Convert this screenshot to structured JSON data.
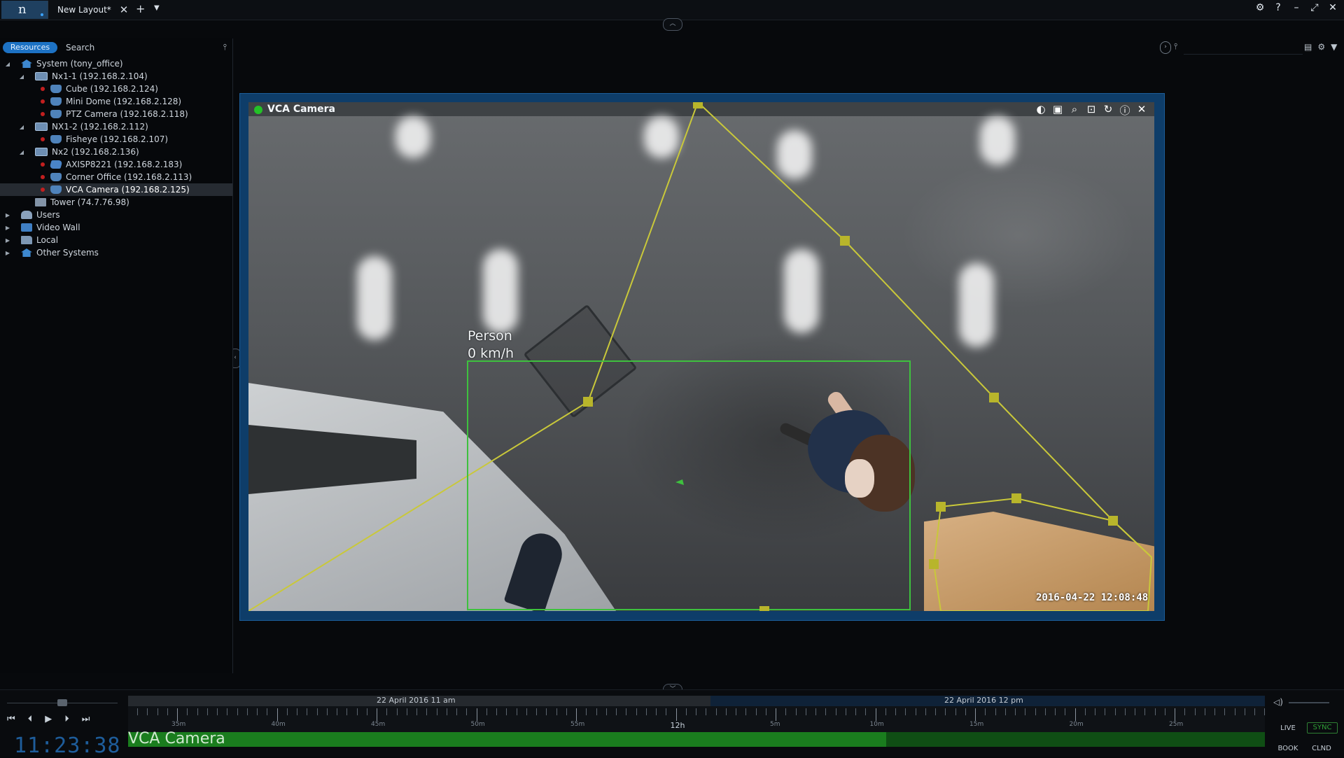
{
  "app": {
    "logo_text": "n",
    "tab_title": "New Layout*",
    "tab_close": "✕",
    "tab_add": "+",
    "tab_menu": "▼",
    "window_controls": [
      "⚙",
      "?",
      "–",
      "⤢",
      "✕"
    ],
    "top_pull_tab": "︿",
    "bottom_pull_tab": "﹀",
    "left_pull_tab": "‹"
  },
  "left_panel": {
    "tabs": {
      "resources": "Resources",
      "search": "Search"
    },
    "pin": "📌",
    "tree": [
      {
        "label": "System (tony_office)",
        "depth": 0,
        "icon": "home-icon",
        "expanded": true,
        "recording": false
      },
      {
        "label": "Nx1-1 (192.168.2.104)",
        "depth": 1,
        "icon": "server-icon",
        "expanded": true,
        "recording": false
      },
      {
        "label": "Cube (192.168.2.124)",
        "depth": 2,
        "icon": "camera-icon",
        "recording": true
      },
      {
        "label": "Mini Dome (192.168.2.128)",
        "depth": 2,
        "icon": "camera-icon",
        "recording": true
      },
      {
        "label": "PTZ Camera (192.168.2.118)",
        "depth": 2,
        "icon": "camera-icon",
        "recording": true
      },
      {
        "label": "NX1-2 (192.168.2.112)",
        "depth": 1,
        "icon": "server-icon",
        "expanded": true,
        "recording": false
      },
      {
        "label": "Fisheye (192.168.2.107)",
        "depth": 2,
        "icon": "camera-icon",
        "recording": true
      },
      {
        "label": "Nx2 (192.168.2.136)",
        "depth": 1,
        "icon": "server-icon",
        "expanded": true,
        "recording": false
      },
      {
        "label": "AXISP8221 (192.168.2.183)",
        "depth": 2,
        "icon": "io-module-icon",
        "recording": true
      },
      {
        "label": "Corner Office (192.168.2.113)",
        "depth": 2,
        "icon": "camera-icon",
        "recording": true
      },
      {
        "label": "VCA Camera (192.168.2.125)",
        "depth": 2,
        "icon": "camera-icon",
        "recording": true,
        "selected": true
      },
      {
        "label": "Tower (74.7.76.98)",
        "depth": 1,
        "icon": "tower-server-icon",
        "recording": false
      },
      {
        "label": "Users",
        "depth": 0,
        "icon": "users-icon",
        "expanded": false,
        "recording": false
      },
      {
        "label": "Video Wall",
        "depth": 0,
        "icon": "video-wall-icon",
        "expanded": false,
        "recording": false
      },
      {
        "label": "Local",
        "depth": 0,
        "icon": "folder-icon",
        "expanded": false,
        "recording": false
      },
      {
        "label": "Other Systems",
        "depth": 0,
        "icon": "home-icon",
        "expanded": false,
        "recording": false
      }
    ]
  },
  "right_search": {
    "pin": "📌",
    "icons": [
      "▤",
      "⚙",
      "▼"
    ]
  },
  "camera_tile": {
    "title": "VCA Camera",
    "status_color": "#23c227",
    "buttons": [
      "◐",
      "▣",
      "⌕",
      "⊡",
      "↻",
      "ⓘ",
      "✕"
    ],
    "object_label_line1": "Person",
    "object_label_line2": "0 km/h",
    "timestamp": "2016-04-22 12:08:48",
    "zone_color": "#c9c83a",
    "bbox_color": "#3ec13e"
  },
  "timeline": {
    "date_left": "22 April 2016 11 am",
    "date_right": "22 April 2016 12 pm",
    "tick_labels": [
      "35m",
      "40m",
      "45m",
      "50m",
      "55m",
      "12h",
      "5m",
      "10m",
      "15m",
      "20m",
      "25m"
    ],
    "camera_name": "VCA Camera",
    "clock": "11:23:38",
    "transport": [
      "⏮",
      "⏴",
      "▶",
      "⏵",
      "⏭"
    ],
    "buttons": {
      "live": "LIVE",
      "sync": "SYNC",
      "book": "BOOK",
      "clnd": "CLND"
    },
    "volume_icon": "🔈"
  },
  "colors": {
    "accent": "#1d72c4",
    "tile_border": "#0e3d69",
    "timeline_green": "#1a7d1e",
    "recording_red": "#c21f1f"
  }
}
